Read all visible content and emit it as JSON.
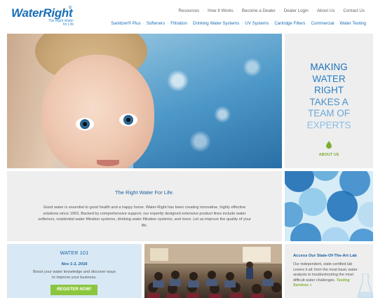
{
  "brand": {
    "name": "WaterRight",
    "tagline": "The Right Water for Life",
    "accent": "#1a6fb7",
    "green": "#8cc63f"
  },
  "utility_nav": [
    "Resources",
    "How It Works",
    "Become a Dealer",
    "Dealer Login",
    "About Us",
    "Contact Us"
  ],
  "main_nav": [
    "Sanitizer® Plus",
    "Softeners",
    "Filtration",
    "Drinking Water Systems",
    "UV Systems",
    "Cartridge Filters",
    "Commercial",
    "Water Testing"
  ],
  "tagline_panel": {
    "lines": [
      "MAKING",
      "WATER",
      "RIGHT",
      "TAKES A",
      "TEAM OF",
      "EXPERTS"
    ],
    "link": "ABOUT US",
    "icon": "water-drop-icon"
  },
  "intro": {
    "title": "The Right Water For Life.",
    "body": "Good water is essential to good health and a happy home. Water-Right has been creating innovative, highly effective solutions since 1963. Backed by comprehensive support, our expertly designed extensive product lines include water softeners, residential water filtration systems, drinking water filtration systems, and more. Let us improve the quality of your life."
  },
  "water101": {
    "title": "WATER 101",
    "date": "Nov 1-3, 2016",
    "body": "Boost your water knowledge and discover ways to improve your business.",
    "button": "REGISTER NOW!"
  },
  "lab": {
    "title": "Access Our State-Of-The-Art Lab",
    "body": "Our independent, state-certified lab covers it all: from the most basic water analysis to troubleshooting the most difficult water challenges.",
    "link": "Testing Services »",
    "icon": "flask-icon"
  }
}
